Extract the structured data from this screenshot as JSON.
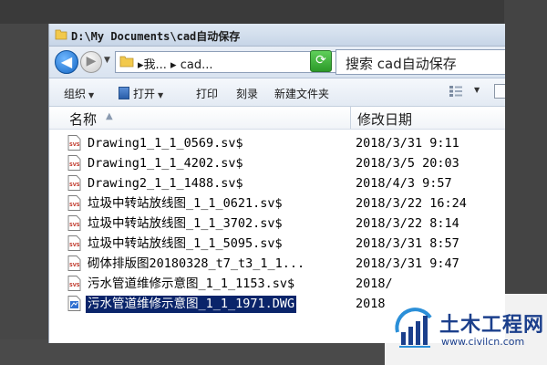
{
  "window": {
    "title": "D:\\My Documents\\cad自动保存"
  },
  "navbar": {
    "back_glyph": "◀",
    "forward_glyph": "▶",
    "history_glyph": "▼",
    "address_path": "▸我... ▸ cad...",
    "address_drop_glyph": "▼",
    "refresh_glyph": "⟳",
    "search_placeholder": "搜索 cad自动保存"
  },
  "toolbar": {
    "organize_label": "组织",
    "open_label": "打开",
    "print_label": "打印",
    "burn_label": "刻录",
    "new_folder_label": "新建文件夹",
    "dropdown_glyph": "▼"
  },
  "columns": {
    "name_label": "名称",
    "sort_glyph": "▲",
    "date_label": "修改日期"
  },
  "files": [
    {
      "name": "Drawing1_1_1_0569.sv$",
      "date": "2018/3/31  9:11",
      "icon": "sv-file-icon",
      "selected": false
    },
    {
      "name": "Drawing1_1_1_4202.sv$",
      "date": "2018/3/5 20:03",
      "icon": "sv-file-icon",
      "selected": false
    },
    {
      "name": "Drawing2_1_1_1488.sv$",
      "date": "2018/4/3  9:57",
      "icon": "sv-file-icon",
      "selected": false
    },
    {
      "name": "垃圾中转站放线图_1_1_0621.sv$",
      "date": "2018/3/22 16:24",
      "icon": "sv-file-icon",
      "selected": false
    },
    {
      "name": "垃圾中转站放线图_1_1_3702.sv$",
      "date": "2018/3/22  8:14",
      "icon": "sv-file-icon",
      "selected": false
    },
    {
      "name": "垃圾中转站放线图_1_1_5095.sv$",
      "date": "2018/3/31  8:57",
      "icon": "sv-file-icon",
      "selected": false
    },
    {
      "name": "砌体排版图20180328_t7_t3_1_1...",
      "date": "2018/3/31  9:47",
      "icon": "sv-file-icon",
      "selected": false
    },
    {
      "name": "污水管道维修示意图_1_1_1153.sv$",
      "date": "2018/",
      "icon": "sv-file-icon",
      "selected": false
    },
    {
      "name": "污水管道维修示意图_1_1_1971.DWG",
      "date": "2018",
      "icon": "dwg-file-icon",
      "selected": true
    }
  ],
  "watermark": {
    "title": "土木工程网",
    "url": "www.civilcn.com"
  },
  "colors": {
    "selection": "#0a246a",
    "brand": "#1b3f8c"
  }
}
